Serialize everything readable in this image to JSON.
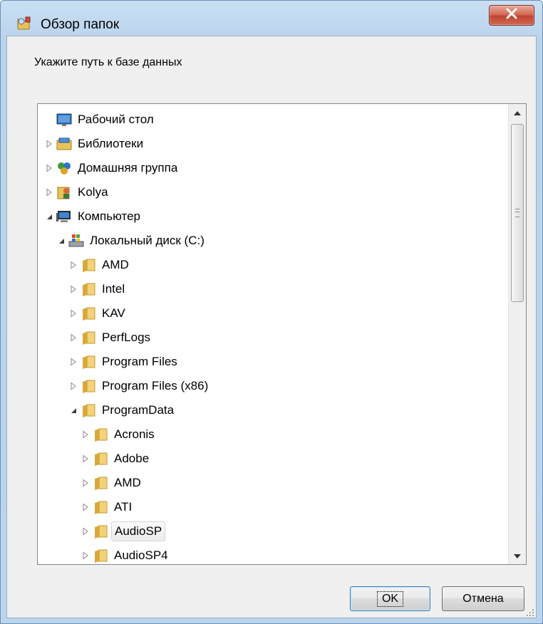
{
  "window": {
    "title": "Обзор папок",
    "close_icon": "close-x-icon",
    "app_icon": "folder-browse-icon"
  },
  "prompt": "Укажите путь к базе данных",
  "tree": {
    "items": [
      {
        "label": "Рабочий стол",
        "level": 0,
        "expander": "none",
        "icon": "desktop-icon"
      },
      {
        "label": "Библиотеки",
        "level": 0,
        "expander": "collapsed",
        "icon": "libraries-icon"
      },
      {
        "label": "Домашняя группа",
        "level": 0,
        "expander": "collapsed",
        "icon": "homegroup-icon"
      },
      {
        "label": "Kolya",
        "level": 0,
        "expander": "collapsed",
        "icon": "user-folder-icon"
      },
      {
        "label": "Компьютер",
        "level": 0,
        "expander": "expanded",
        "icon": "computer-icon"
      },
      {
        "label": "Локальный диск (C:)",
        "level": 1,
        "expander": "expanded",
        "icon": "drive-icon"
      },
      {
        "label": "AMD",
        "level": 2,
        "expander": "collapsed",
        "icon": "folder-icon"
      },
      {
        "label": "Intel",
        "level": 2,
        "expander": "collapsed",
        "icon": "folder-icon"
      },
      {
        "label": "KAV",
        "level": 2,
        "expander": "collapsed",
        "icon": "folder-icon"
      },
      {
        "label": "PerfLogs",
        "level": 2,
        "expander": "collapsed",
        "icon": "folder-icon"
      },
      {
        "label": "Program Files",
        "level": 2,
        "expander": "collapsed",
        "icon": "folder-icon"
      },
      {
        "label": "Program Files (x86)",
        "level": 2,
        "expander": "collapsed",
        "icon": "folder-icon"
      },
      {
        "label": "ProgramData",
        "level": 2,
        "expander": "expanded",
        "icon": "folder-icon"
      },
      {
        "label": "Acronis",
        "level": 3,
        "expander": "collapsed",
        "icon": "folder-icon"
      },
      {
        "label": "Adobe",
        "level": 3,
        "expander": "collapsed",
        "icon": "folder-icon"
      },
      {
        "label": "AMD",
        "level": 3,
        "expander": "collapsed",
        "icon": "folder-icon"
      },
      {
        "label": "ATI",
        "level": 3,
        "expander": "collapsed",
        "icon": "folder-icon"
      },
      {
        "label": "AudioSP",
        "level": 3,
        "expander": "collapsed",
        "icon": "folder-icon",
        "selected": true
      },
      {
        "label": "AudioSP4",
        "level": 3,
        "expander": "collapsed",
        "icon": "folder-icon"
      }
    ]
  },
  "buttons": {
    "ok_label": "OK",
    "cancel_label": "Отмена"
  },
  "colors": {
    "title_bar": "#bcd5ee",
    "close_button": "#c9533d",
    "dialog_bg": "#f0f0f0",
    "folder": "#e8c25a"
  }
}
